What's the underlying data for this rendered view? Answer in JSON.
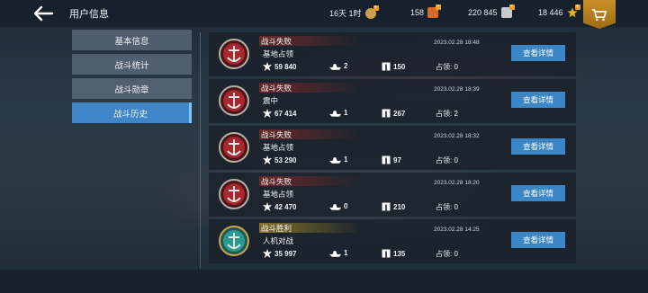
{
  "header": {
    "title": "用户信息",
    "resources": [
      {
        "name": "premium-time",
        "value": "16天 1时",
        "color": "#c9a24a"
      },
      {
        "name": "gold",
        "value": "158",
        "color": "#d96a2a"
      },
      {
        "name": "silver",
        "value": "220 845",
        "color": "#c7c9cc"
      },
      {
        "name": "exp",
        "value": "18 446",
        "color": "#e0b030"
      }
    ],
    "accent_color": "#c89028"
  },
  "sidebar": {
    "items": [
      {
        "label": "基本信息",
        "active": false
      },
      {
        "label": "战斗统计",
        "active": false
      },
      {
        "label": "战斗勋章",
        "active": false
      },
      {
        "label": "战斗历史",
        "active": true
      }
    ],
    "active_color": "#3e86c8"
  },
  "battles": [
    {
      "result": "战斗失败",
      "mode": "基地占领",
      "date": "2023.02.28 18:48",
      "damage": "59 840",
      "kills": "2",
      "exp": "150",
      "capture": "占领: 0",
      "detail_label": "查看详情",
      "emblem": "defeat-emblem"
    },
    {
      "result": "战斗失败",
      "mode": "震中",
      "date": "2023.02.28 18:39",
      "damage": "67 414",
      "kills": "1",
      "exp": "267",
      "capture": "占领: 2",
      "detail_label": "查看详情",
      "emblem": "defeat-emblem"
    },
    {
      "result": "战斗失败",
      "mode": "基地占领",
      "date": "2023.02.28 18:32",
      "damage": "53 290",
      "kills": "1",
      "exp": "97",
      "capture": "占领: 0",
      "detail_label": "查看详情",
      "emblem": "defeat-emblem"
    },
    {
      "result": "战斗失败",
      "mode": "基地占领",
      "date": "2023.02.28 18:20",
      "damage": "42 470",
      "kills": "0",
      "exp": "210",
      "capture": "占领: 0",
      "detail_label": "查看详情",
      "emblem": "defeat-emblem"
    },
    {
      "result": "战斗胜利",
      "mode": "人机对战",
      "date": "2023.02.28 14:25",
      "damage": "35 997",
      "kills": "1",
      "exp": "135",
      "capture": "占领: 0",
      "detail_label": "查看详情",
      "emblem": "victory-emblem"
    }
  ],
  "colors": {
    "defeat": "#a8262c",
    "victory": "#2a9a8e",
    "button": "#3a86c6"
  }
}
